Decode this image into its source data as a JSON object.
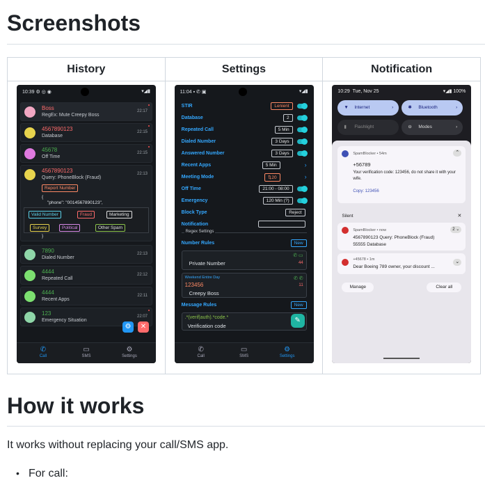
{
  "section1_title": "Screenshots",
  "table_headers": [
    "History",
    "Settings",
    "Notification"
  ],
  "history": {
    "status_time": "10:39",
    "rows": [
      {
        "number": "Boss",
        "sub": "RegEx: Mute Creepy Boss",
        "time": "22:17",
        "color": "#ff6b6b"
      },
      {
        "number": "4567890123",
        "sub": "Database",
        "time": "22:15",
        "color": "#ff6b6b"
      },
      {
        "number": "45678",
        "sub": "Off Time",
        "time": "22:15",
        "color": "#4caf50"
      },
      {
        "number": "4567890123",
        "sub": "Query: PhoneBlock (Fraud)",
        "time": "22:13",
        "color": "#ff6b6b"
      },
      {
        "number": "7890",
        "sub": "Dialed Number",
        "time": "22:13",
        "color": "#4caf50"
      },
      {
        "number": "4444",
        "sub": "Repeated Call",
        "time": "22:12",
        "color": "#4caf50"
      },
      {
        "number": "4444",
        "sub": "Recent Apps",
        "time": "22:11",
        "color": "#4caf50"
      },
      {
        "number": "123",
        "sub": "Emergency Situation",
        "time": "22:07",
        "color": "#4caf50"
      }
    ],
    "report_label": "Report Number",
    "json_open": "{",
    "json_line": "\"phone\": \"0014567890123\",",
    "json_close": "}",
    "tags": [
      "Valid Number",
      "Fraud",
      "Marketing",
      "Survey",
      "Political",
      "Other Spam"
    ],
    "nav": [
      "Call",
      "SMS",
      "Settings"
    ]
  },
  "settings": {
    "status_time": "11:04",
    "rows": [
      {
        "label": "STIR",
        "value": "Lenient"
      },
      {
        "label": "Database",
        "value": "2"
      },
      {
        "label": "Repeated Call",
        "value": "5 Min"
      },
      {
        "label": "Dialed Number",
        "value": "3 Days"
      },
      {
        "label": "Answered Number",
        "value": "3 Days"
      },
      {
        "label": "Recent Apps",
        "value": "5 Min"
      },
      {
        "label": "Meeting Mode",
        "value": "⇅20"
      },
      {
        "label": "Off Time",
        "value": "21:00 - 08:00"
      },
      {
        "label": "Emergency",
        "value": "120 Min (?)"
      },
      {
        "label": "Block Type",
        "value": "Reject"
      },
      {
        "label": "Notification",
        "value": ""
      }
    ],
    "regex_header": "Regex Settings",
    "number_rules_label": "Number Rules",
    "new_label": "New",
    "private_number": "Private Number",
    "rule_count_1": "44",
    "weekend_label": "Weekend  Entire Day",
    "rule_number": "123456",
    "creepy_boss": "Creepy Boss",
    "rule_count_2": "11",
    "message_rules_label": "Message Rules",
    "regex_pattern": ".*(verif|auth).*code.*",
    "verification_code": "Verification code",
    "nav": [
      "Call",
      "SMS",
      "Settings"
    ]
  },
  "notification": {
    "status_time": "10:29",
    "status_date": "Tue, Nov 25",
    "battery": "100%",
    "tiles": [
      "Internet",
      "Bluetooth",
      "Flashlight",
      "Modes"
    ],
    "card1_app": "SpamBlocker • 54m",
    "card1_number": "+56789",
    "card1_text": "Your verification code: 123456, do not share it with your wife.",
    "card1_copy": "Copy: 123456",
    "silent_label": "Silent",
    "card2_app": "SpamBlocker • now",
    "card2_line1": "4567890123 Query: PhoneBlock (Fraud)",
    "card2_line2": "55555 Database",
    "card2_badge": "2",
    "card3_app": "+45678 • 1m",
    "card3_text": "Dear Boeing 789 owner, your discount ...",
    "manage": "Manage",
    "clear_all": "Clear all"
  },
  "section2_title": "How it works",
  "paragraph": "It works without replacing your call/SMS app.",
  "list_item": "For call:"
}
